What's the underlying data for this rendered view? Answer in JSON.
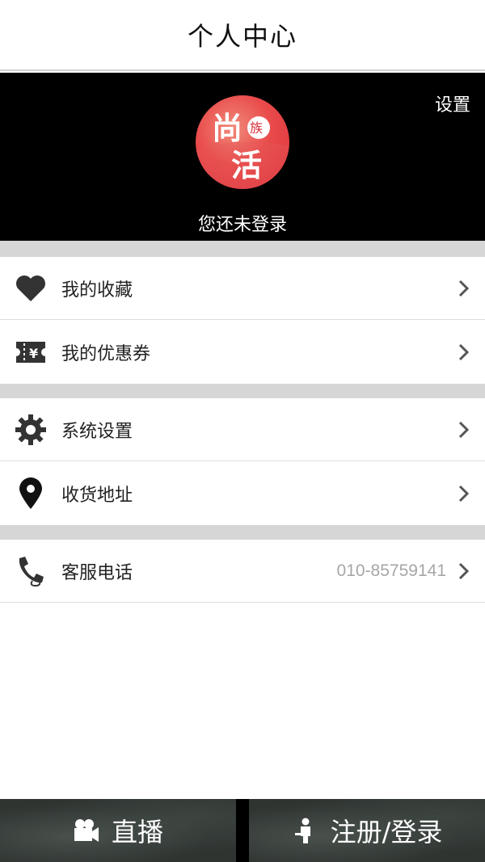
{
  "header": {
    "title": "个人中心"
  },
  "profile": {
    "settings_label": "设置",
    "avatar_logo": {
      "big1": "尚",
      "small": "族",
      "big2": "活"
    },
    "login_status": "您还未登录"
  },
  "menu": {
    "favorites": {
      "label": "我的收藏",
      "icon": "heart-icon"
    },
    "coupons": {
      "label": "我的优惠券",
      "icon": "coupon-icon"
    },
    "system_settings": {
      "label": "系统设置",
      "icon": "gear-icon"
    },
    "address": {
      "label": "收货地址",
      "icon": "location-pin-icon"
    },
    "service": {
      "label": "客服电话",
      "value": "010-85759141",
      "icon": "phone-icon"
    }
  },
  "bottom_nav": {
    "live": {
      "label": "直播",
      "icon": "video-camera-icon"
    },
    "login": {
      "label": "注册/登录",
      "icon": "person-icon"
    }
  },
  "colors": {
    "header_bg": "#ffffff",
    "profile_bg": "#000000",
    "avatar_red": "#e94b4b",
    "section_gap": "#d6d6d6",
    "secondary_text": "#a6a6a6"
  }
}
